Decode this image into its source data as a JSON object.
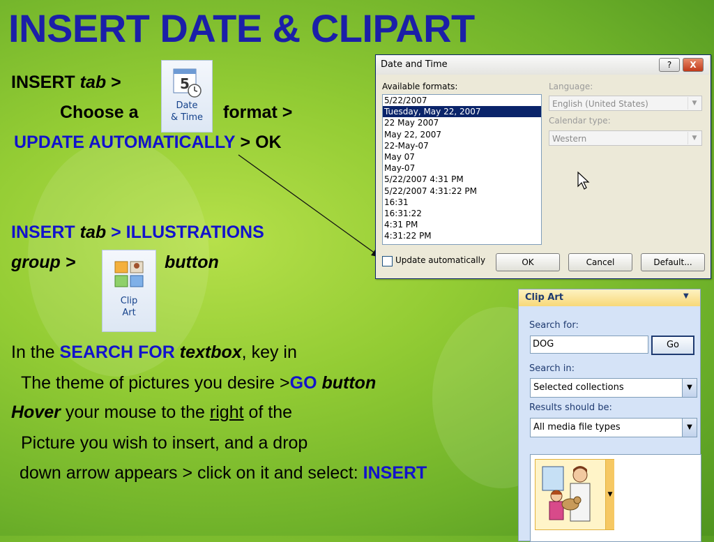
{
  "title": "INSERT DATE & CLIPART",
  "instructions": {
    "l1_insert": "INSERT",
    "l1_tab": "tab",
    "l1_arrow": ">",
    "l2_choose": "Choose a",
    "l2_format": "format >",
    "l3_update": "UPDATE AUTOMATICALLY",
    "l3_rest": ">  OK",
    "l4_insert": "INSERT",
    "l4_tab": "tab",
    "l4_illus": "> ILLUSTRATIONS",
    "l5_group": "group  >",
    "l5_button": "button",
    "l6_a": "In the",
    "l6_b": "SEARCH FOR",
    "l6_c": "textbox",
    "l6_d": ", key in",
    "l7_a": "The theme of pictures you desire  >",
    "l7_b": "GO",
    "l7_c": "button",
    "l8_a": "Hover",
    "l8_b": "your mouse to the",
    "l8_c": "right",
    "l8_d": "of the",
    "l9": "Picture you wish to insert, and a drop",
    "l10_a": "down arrow appears > click on it and select:",
    "l10_b": "INSERT"
  },
  "date_time_button": {
    "day": "5",
    "label1": "Date",
    "label2": "& Time"
  },
  "clip_art_button": {
    "label1": "Clip",
    "label2": "Art"
  },
  "dialog": {
    "title": "Date and Time",
    "help_label": "?",
    "close_label": "X",
    "formats_label": "Available formats:",
    "formats": [
      "5/22/2007",
      "Tuesday, May 22, 2007",
      "22 May 2007",
      "May 22, 2007",
      "22-May-07",
      "May 07",
      "May-07",
      "5/22/2007 4:31 PM",
      "5/22/2007 4:31:22 PM",
      "16:31",
      "16:31:22",
      "4:31 PM",
      "4:31:22 PM"
    ],
    "selected_format": "Tuesday, May 22, 2007",
    "language_label": "Language:",
    "language_value": "English (United States)",
    "calendar_label": "Calendar type:",
    "calendar_value": "Western",
    "update_label": "Update automatically",
    "update_checked": false,
    "ok": "OK",
    "cancel": "Cancel",
    "default": "Default..."
  },
  "clip_art": {
    "title": "Clip Art",
    "search_label": "Search for:",
    "search_value": "DOG",
    "go": "Go",
    "search_in_label": "Search in:",
    "search_in_value": "Selected collections",
    "results_label": "Results should be:",
    "results_value": "All media file types"
  },
  "colors": {
    "title": "#1b1fa8",
    "keyword": "#1212cc",
    "background": "#93cc34"
  }
}
